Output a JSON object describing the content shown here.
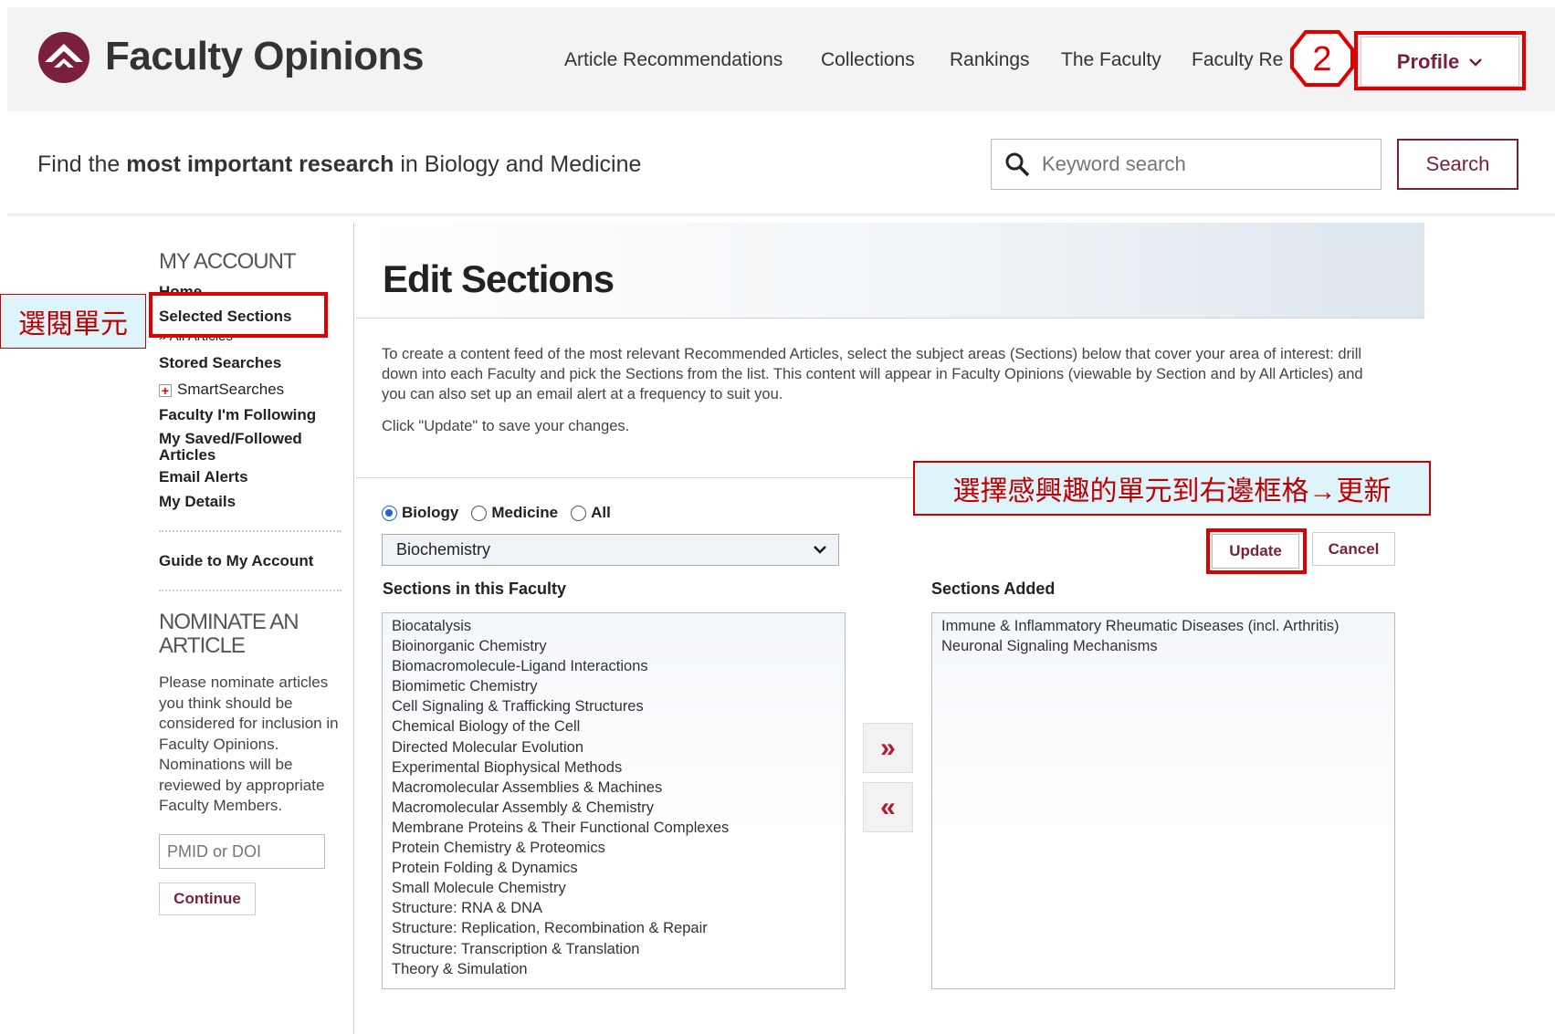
{
  "header": {
    "logo_text": "Faculty Opinions",
    "nav": [
      "Article Recommendations",
      "Collections",
      "Rankings",
      "The Faculty",
      "Faculty Reviews"
    ],
    "profile_label": "Profile",
    "step_number": "2"
  },
  "search": {
    "tagline_pre": "Find the ",
    "tagline_bold": "most important research",
    "tagline_post": " in Biology and Medicine",
    "placeholder": "Keyword search",
    "button": "Search"
  },
  "sidebar": {
    "heading": "MY ACCOUNT",
    "home": "Home",
    "selected_sections": "Selected Sections",
    "all_articles": "» All Articles",
    "stored_searches": "Stored Searches",
    "smart_searches": "SmartSearches",
    "faculty_following": "Faculty I'm Following",
    "saved_articles": "My Saved/Followed Articles",
    "email_alerts": "Email Alerts",
    "my_details": "My Details",
    "guide": "Guide to My Account",
    "nominate_heading_1": "NOMINATE AN",
    "nominate_heading_2": "ARTICLE",
    "nominate_text": "Please nominate articles you think should be considered for inclusion in Faculty Opinions. Nominations will be reviewed by appropriate Faculty Members.",
    "pmid_placeholder": "PMID or DOI",
    "continue": "Continue"
  },
  "annotations": {
    "left_callout": "選閱單元",
    "right_callout": "選擇感興趣的單元到右邊框格→更新"
  },
  "main": {
    "title": "Edit Sections",
    "intro": "To create a content feed of the most relevant Recommended Articles, select the subject areas (Sections) below that cover your area of interest: drill down into each Faculty and pick the Sections from the list. This content will appear in Faculty Opinions (viewable by Section and by All Articles) and you can also set up an email alert at a frequency to suit you.",
    "intro2": "Click \"Update\" to save your changes.",
    "radios": [
      "Biology",
      "Medicine",
      "All"
    ],
    "selected_radio": "Biology",
    "faculty_select": "Biochemistry",
    "update": "Update",
    "cancel": "Cancel",
    "sections_heading": "Sections in this Faculty",
    "added_heading": "Sections Added",
    "sections": [
      "Biocatalysis",
      "Bioinorganic Chemistry",
      "Biomacromolecule-Ligand Interactions",
      "Biomimetic Chemistry",
      "Cell Signaling & Trafficking Structures",
      "Chemical Biology of the Cell",
      "Directed Molecular Evolution",
      "Experimental Biophysical Methods",
      "Macromolecular Assemblies & Machines",
      "Macromolecular Assembly & Chemistry",
      "Membrane Proteins & Their Functional Complexes",
      "Protein Chemistry & Proteomics",
      "Protein Folding & Dynamics",
      "Small Molecule Chemistry",
      "Structure: RNA & DNA",
      "Structure: Replication, Recombination & Repair",
      "Structure: Transcription & Translation",
      "Theory & Simulation"
    ],
    "added": [
      "Immune & Inflammatory Rheumatic Diseases (incl. Arthritis)",
      "Neuronal Signaling Mechanisms"
    ],
    "add_symbol": "»",
    "remove_symbol": "«"
  },
  "colors": {
    "brand": "#7a1f3d",
    "annotation_red": "#e00000",
    "callout_bg": "#def4fb"
  }
}
